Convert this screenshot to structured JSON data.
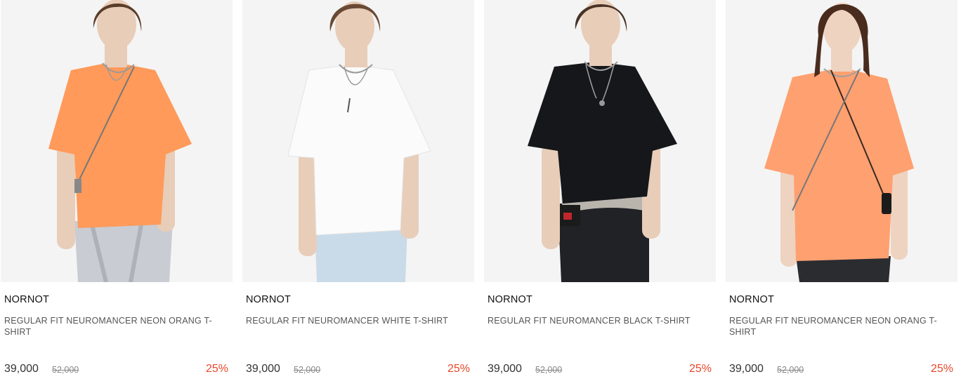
{
  "products": [
    {
      "brand": "NORNOT",
      "name": "REGULAR FIT NEUROMANCER NEON ORANG T-SHIRT",
      "price": "39,000",
      "original_price": "52,000",
      "discount": "25%",
      "shirt_color": "#ff9a5a",
      "pants_color": "#c9ccd2",
      "image_alt": "model wearing neon orange t-shirt"
    },
    {
      "brand": "NORNOT",
      "name": "REGULAR FIT NEUROMANCER WHITE T-SHIRT",
      "price": "39,000",
      "original_price": "52,000",
      "discount": "25%",
      "shirt_color": "#fbfbfb",
      "pants_color": "#c9dbe8",
      "image_alt": "model wearing white t-shirt"
    },
    {
      "brand": "NORNOT",
      "name": "REGULAR FIT NEUROMANCER BLACK T-SHIRT",
      "price": "39,000",
      "original_price": "52,000",
      "discount": "25%",
      "shirt_color": "#15171a",
      "pants_color": "#202226",
      "image_alt": "model wearing black t-shirt"
    },
    {
      "brand": "NORNOT",
      "name": "REGULAR FIT NEUROMANCER NEON ORANG T-SHIRT",
      "price": "39,000",
      "original_price": "52,000",
      "discount": "25%",
      "shirt_color": "#ffa070",
      "pants_color": "#2a2c30",
      "image_alt": "model wearing neon orange t-shirt"
    }
  ],
  "colors": {
    "discount": "#e8472a",
    "photo_background": "#f3f3f3"
  }
}
